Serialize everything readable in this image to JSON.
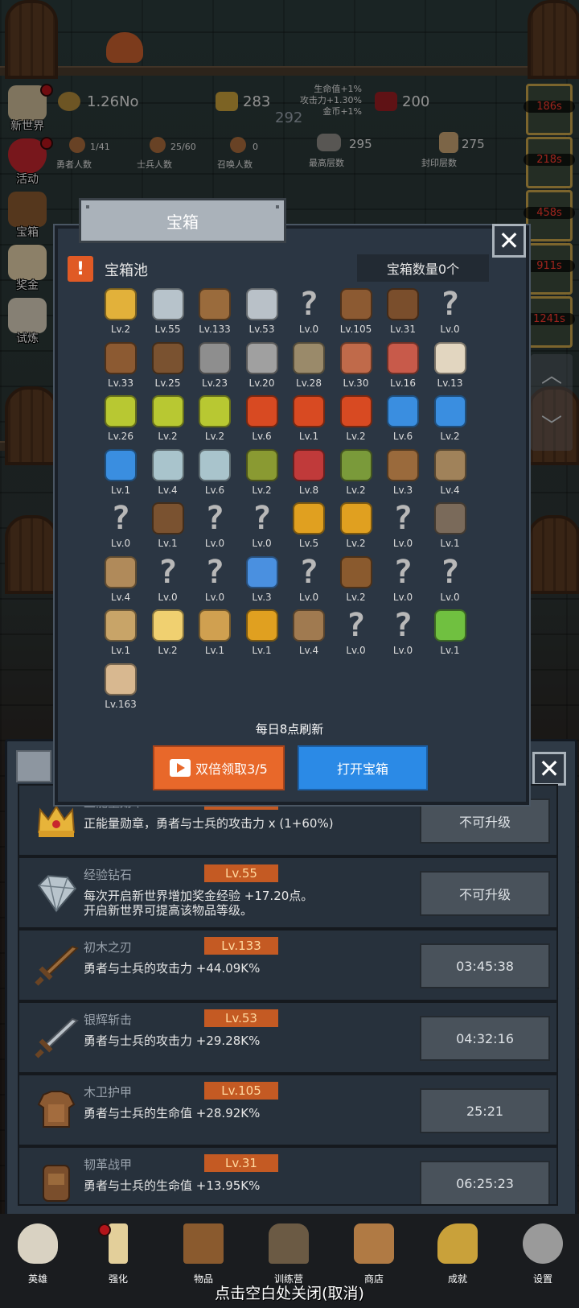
{
  "top": {
    "gold": "1.26No",
    "bars": "283",
    "gems": "200",
    "buff_total": "292",
    "buffs": [
      "生命值+1%",
      "攻击力+1.30%",
      "金币+1%"
    ],
    "heroes": {
      "value": "1/41",
      "label": "勇者人数"
    },
    "soldiers": {
      "value": "25/60",
      "label": "士兵人数"
    },
    "summons": {
      "value": "0",
      "label": "召唤人数"
    },
    "max_floor": {
      "value": "295",
      "label": "最高层数"
    },
    "seal_floor": {
      "value": "275",
      "label": "封印层数"
    }
  },
  "side_menu": [
    {
      "label": "新世界",
      "icon": "castle-icon"
    },
    {
      "label": "活动",
      "icon": "heart-icon"
    },
    {
      "label": "宝箱",
      "icon": "chest-icon"
    },
    {
      "label": "奖金",
      "icon": "envelope-icon"
    },
    {
      "label": "试炼",
      "icon": "feather-icon"
    }
  ],
  "timers": [
    "186s",
    "218s",
    "458s",
    "911s",
    "1241s"
  ],
  "modal": {
    "title": "宝箱",
    "pool_title": "宝箱池",
    "chest_count": "宝箱数量0个",
    "close": "✕",
    "refresh_note": "每日8点刷新",
    "double_button": "双倍领取3/5",
    "open_button": "打开宝箱",
    "items": [
      {
        "icon": "crown-icon",
        "lv": "Lv.2"
      },
      {
        "icon": "diamond-icon",
        "lv": "Lv.55"
      },
      {
        "icon": "wood-sword-icon",
        "lv": "Lv.133"
      },
      {
        "icon": "silver-sword-icon",
        "lv": "Lv.53"
      },
      {
        "icon": "unknown-icon",
        "lv": "Lv.0"
      },
      {
        "icon": "leather-armor-icon",
        "lv": "Lv.105"
      },
      {
        "icon": "backpack-armor-icon",
        "lv": "Lv.31"
      },
      {
        "icon": "unknown-icon",
        "lv": "Lv.0"
      },
      {
        "icon": "leather-helmet-icon",
        "lv": "Lv.33"
      },
      {
        "icon": "dagger-icon",
        "lv": "Lv.25"
      },
      {
        "icon": "knight-helmet-icon",
        "lv": "Lv.23"
      },
      {
        "icon": "hammer-icon",
        "lv": "Lv.20"
      },
      {
        "icon": "great-helm-icon",
        "lv": "Lv.28"
      },
      {
        "icon": "ham-icon",
        "lv": "Lv.30"
      },
      {
        "icon": "steak-icon",
        "lv": "Lv.16"
      },
      {
        "icon": "bread-icon",
        "lv": "Lv.13"
      },
      {
        "icon": "yellow-potion-icon",
        "lv": "Lv.26"
      },
      {
        "icon": "yellow-potion-icon",
        "lv": "Lv.2"
      },
      {
        "icon": "yellow-potion-icon",
        "lv": "Lv.2"
      },
      {
        "icon": "red-potion-icon",
        "lv": "Lv.6"
      },
      {
        "icon": "red-potion-icon",
        "lv": "Lv.1"
      },
      {
        "icon": "red-potion-icon",
        "lv": "Lv.2"
      },
      {
        "icon": "blue-potion-icon",
        "lv": "Lv.6"
      },
      {
        "icon": "blue-potion-icon",
        "lv": "Lv.2"
      },
      {
        "icon": "blue-potion-icon",
        "lv": "Lv.1"
      },
      {
        "icon": "empty-bottle-icon",
        "lv": "Lv.4"
      },
      {
        "icon": "empty-bottle-icon",
        "lv": "Lv.6"
      },
      {
        "icon": "green-bottle-icon",
        "lv": "Lv.2"
      },
      {
        "icon": "red-bottle-icon",
        "lv": "Lv.8"
      },
      {
        "icon": "winged-boot-icon",
        "lv": "Lv.2"
      },
      {
        "icon": "leather-boot-icon",
        "lv": "Lv.3"
      },
      {
        "icon": "brown-boot-icon",
        "lv": "Lv.4"
      },
      {
        "icon": "unknown-icon",
        "lv": "Lv.0"
      },
      {
        "icon": "stick-icon",
        "lv": "Lv.1"
      },
      {
        "icon": "unknown-icon",
        "lv": "Lv.0"
      },
      {
        "icon": "unknown-icon",
        "lv": "Lv.0"
      },
      {
        "icon": "torch-icon",
        "lv": "Lv.5"
      },
      {
        "icon": "torch-icon",
        "lv": "Lv.2"
      },
      {
        "icon": "unknown-icon",
        "lv": "Lv.0"
      },
      {
        "icon": "pickaxe-icon",
        "lv": "Lv.1"
      },
      {
        "icon": "staff-icon",
        "lv": "Lv.4"
      },
      {
        "icon": "unknown-icon",
        "lv": "Lv.0"
      },
      {
        "icon": "unknown-icon",
        "lv": "Lv.0"
      },
      {
        "icon": "blue-wand-icon",
        "lv": "Lv.3"
      },
      {
        "icon": "unknown-icon",
        "lv": "Lv.0"
      },
      {
        "icon": "backpack-icon",
        "lv": "Lv.2"
      },
      {
        "icon": "unknown-icon",
        "lv": "Lv.0"
      },
      {
        "icon": "unknown-icon",
        "lv": "Lv.0"
      },
      {
        "icon": "wood-stake-icon",
        "lv": "Lv.1"
      },
      {
        "icon": "cheese-icon",
        "lv": "Lv.2"
      },
      {
        "icon": "pie-icon",
        "lv": "Lv.1"
      },
      {
        "icon": "honey-jar-icon",
        "lv": "Lv.1"
      },
      {
        "icon": "bow-icon",
        "lv": "Lv.4"
      },
      {
        "icon": "unknown-icon",
        "lv": "Lv.0"
      },
      {
        "icon": "unknown-icon",
        "lv": "Lv.0"
      },
      {
        "icon": "green-wand-icon",
        "lv": "Lv.1"
      },
      {
        "icon": "beer-mug-icon",
        "lv": "Lv.163"
      }
    ]
  },
  "list": {
    "close": "✕",
    "rows": [
      {
        "icon": "crown-icon",
        "name": "正能量勋章",
        "lv": "Lv.2",
        "desc": [
          "正能量勋章，勇者与士兵的攻击力 x (1+60%)"
        ],
        "action": "不可升级"
      },
      {
        "icon": "diamond-icon",
        "name": "经验钻石",
        "lv": "Lv.55",
        "desc": [
          "每次开启新世界增加奖金经验 +17.20点。",
          "开启新世界可提高该物品等级。"
        ],
        "action": "不可升级"
      },
      {
        "icon": "wood-sword-icon",
        "name": "初木之刃",
        "lv": "Lv.133",
        "desc": [
          "勇者与士兵的攻击力 +44.09K%"
        ],
        "action": "03:45:38"
      },
      {
        "icon": "silver-sword-icon",
        "name": "银辉斩击",
        "lv": "Lv.53",
        "desc": [
          "勇者与士兵的攻击力 +29.28K%"
        ],
        "action": "04:32:16"
      },
      {
        "icon": "leather-armor-icon",
        "name": "木卫护甲",
        "lv": "Lv.105",
        "desc": [
          "勇者与士兵的生命值 +28.92K%"
        ],
        "action": "25:21"
      },
      {
        "icon": "backpack-armor-icon",
        "name": "韧革战甲",
        "lv": "Lv.31",
        "desc": [
          "勇者与士兵的生命值 +13.95K%"
        ],
        "action": "06:25:23"
      }
    ]
  },
  "nav": [
    {
      "label": "英雄",
      "icon": "skull-icon"
    },
    {
      "label": "强化",
      "icon": "candle-icon"
    },
    {
      "label": "物品",
      "icon": "book-icon"
    },
    {
      "label": "训练营",
      "icon": "lantern-icon"
    },
    {
      "label": "商店",
      "icon": "mug-icon"
    },
    {
      "label": "成就",
      "icon": "key-icon"
    },
    {
      "label": "设置",
      "icon": "gear-icon"
    }
  ],
  "close_hint": "点击空白处关闭(取消)",
  "colors": {
    "accent_orange": "#e8682a",
    "accent_blue": "#2b8ae6",
    "level_badge": "#c45a23",
    "timer_red": "#ff3b30",
    "panel": "#2b3643"
  }
}
